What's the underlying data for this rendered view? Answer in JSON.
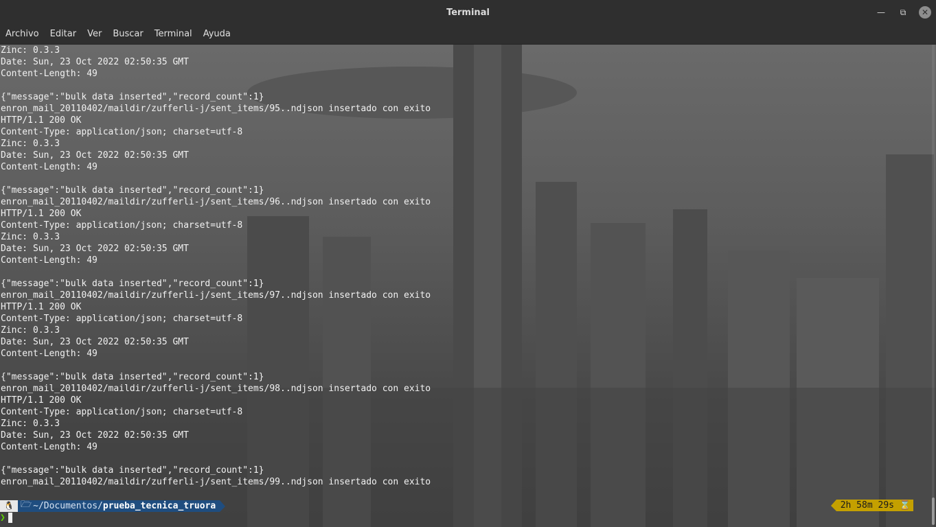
{
  "window": {
    "title": "Terminal",
    "controls": [
      "minimize-icon",
      "maximize-icon",
      "close-icon"
    ]
  },
  "menu": [
    "Archivo",
    "Editar",
    "Ver",
    "Buscar",
    "Terminal",
    "Ayuda"
  ],
  "output_lines": [
    "Zinc: 0.3.3",
    "Date: Sun, 23 Oct 2022 02:50:35 GMT",
    "Content-Length: 49",
    "",
    "{\"message\":\"bulk data inserted\",\"record_count\":1}",
    "enron_mail_20110402/maildir/zufferli-j/sent_items/95..ndjson insertado con exito",
    "HTTP/1.1 200 OK",
    "Content-Type: application/json; charset=utf-8",
    "Zinc: 0.3.3",
    "Date: Sun, 23 Oct 2022 02:50:35 GMT",
    "Content-Length: 49",
    "",
    "{\"message\":\"bulk data inserted\",\"record_count\":1}",
    "enron_mail_20110402/maildir/zufferli-j/sent_items/96..ndjson insertado con exito",
    "HTTP/1.1 200 OK",
    "Content-Type: application/json; charset=utf-8",
    "Zinc: 0.3.3",
    "Date: Sun, 23 Oct 2022 02:50:35 GMT",
    "Content-Length: 49",
    "",
    "{\"message\":\"bulk data inserted\",\"record_count\":1}",
    "enron_mail_20110402/maildir/zufferli-j/sent_items/97..ndjson insertado con exito",
    "HTTP/1.1 200 OK",
    "Content-Type: application/json; charset=utf-8",
    "Zinc: 0.3.3",
    "Date: Sun, 23 Oct 2022 02:50:35 GMT",
    "Content-Length: 49",
    "",
    "{\"message\":\"bulk data inserted\",\"record_count\":1}",
    "enron_mail_20110402/maildir/zufferli-j/sent_items/98..ndjson insertado con exito",
    "HTTP/1.1 200 OK",
    "Content-Type: application/json; charset=utf-8",
    "Zinc: 0.3.3",
    "Date: Sun, 23 Oct 2022 02:50:35 GMT",
    "Content-Length: 49",
    "",
    "{\"message\":\"bulk data inserted\",\"record_count\":1}",
    "enron_mail_20110402/maildir/zufferli-j/sent_items/99..ndjson insertado con exito"
  ],
  "prompt": {
    "os_icon": "linux-penguin-icon",
    "path_prefix": "~/Documentos/",
    "path_current": "prueba_tecnica_truora",
    "elapsed": "2h 58m 29s",
    "elapsed_icon": "hourglass-icon",
    "prompt_symbol": "❯"
  },
  "colors": {
    "titlebar": "#2f2f2f",
    "dir_segment": "#1f4d7f",
    "time_segment": "#c4a000",
    "prompt_chevron": "#5fd700"
  }
}
